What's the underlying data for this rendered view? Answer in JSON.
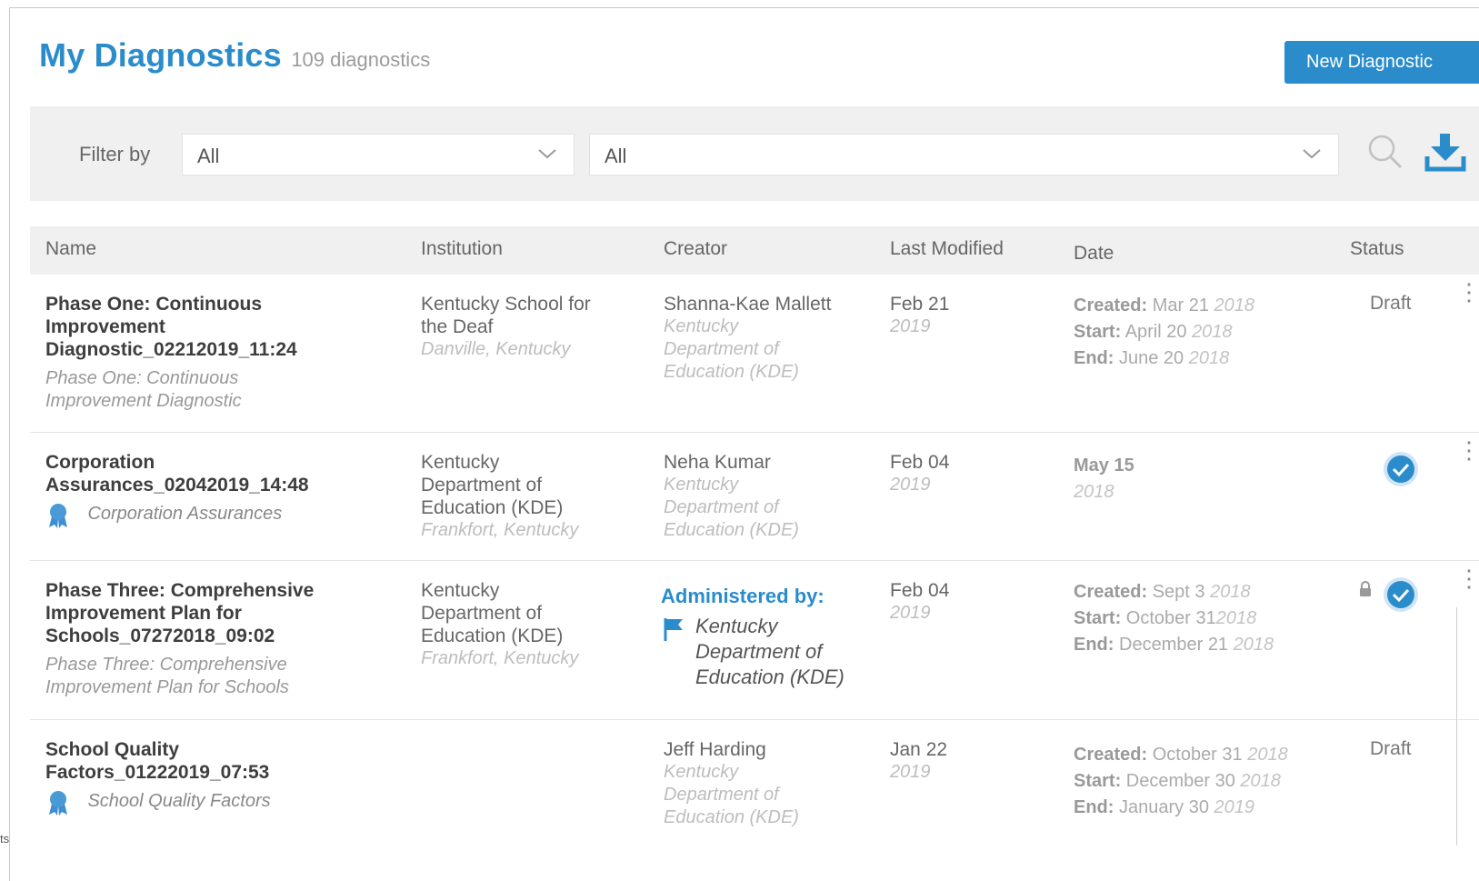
{
  "header": {
    "title": "My Diagnostics",
    "count": "109 diagnostics",
    "new_button": "New Diagnostic"
  },
  "filter": {
    "label": "Filter by",
    "select1": "All",
    "select2": "All",
    "icons": [
      "search-icon",
      "download-icon",
      "chevron-down-icon"
    ]
  },
  "columns": [
    "Name",
    "Institution",
    "Creator",
    "Last Modified",
    "Date",
    "Status"
  ],
  "rows": [
    {
      "name_lines": [
        "Phase One: Continuous",
        "Improvement",
        "Diagnostic_02212019_11:24"
      ],
      "sub_lines": [
        "Phase One: Continuous",
        "Improvement Diagnostic"
      ],
      "institution_lines": [
        "Kentucky School for",
        "the Deaf"
      ],
      "institution_location": "Danville, Kentucky",
      "creator": "Shanna-Kae Mallett",
      "creator_org_lines": [
        "Kentucky",
        "Department of",
        "Education (KDE)"
      ],
      "modified_date": "Feb 21",
      "modified_year": "2019",
      "created_label": "Created:",
      "created_date": "Mar 21",
      "created_year": "2018",
      "start_label": "Start:",
      "start_date": "April 20",
      "start_year": "2018",
      "end_label": "End:",
      "end_date": "June 20",
      "end_year": "2018",
      "status": "Draft"
    },
    {
      "name_lines": [
        "Corporation",
        "Assurances_02042019_14:48"
      ],
      "sub": "Corporation Assurances",
      "institution_lines": [
        "Kentucky",
        "Department of",
        "Education (KDE)"
      ],
      "institution_location": "Frankfort, Kentucky",
      "creator": "Neha Kumar",
      "creator_org_lines": [
        "Kentucky",
        "Department of",
        "Education (KDE)"
      ],
      "modified_date": "Feb 04",
      "modified_year": "2019",
      "date_main": "May 15",
      "date_year": "2018",
      "status": "complete"
    },
    {
      "name_lines": [
        "Phase Three: Comprehensive",
        "Improvement Plan for",
        "Schools_07272018_09:02"
      ],
      "sub_lines": [
        "Phase Three: Comprehensive",
        "Improvement Plan for Schools"
      ],
      "institution_lines": [
        "Kentucky",
        "Department of",
        "Education (KDE)"
      ],
      "institution_location": "Frankfort, Kentucky",
      "admin_label": "Administered by:",
      "admin_org_lines": [
        "Kentucky",
        "Department of",
        "Education (KDE)"
      ],
      "modified_date": "Feb 04",
      "modified_year": "2019",
      "created_label": "Created:",
      "created_date": "Sept 3",
      "created_year": "2018",
      "start_label": "Start:",
      "start_date": "October 31",
      "start_year": "2018",
      "end_label": "End:",
      "end_date": "December 21",
      "end_year": "2018",
      "status": "locked-complete"
    },
    {
      "name_lines": [
        "School Quality",
        "Factors_01222019_07:53"
      ],
      "sub": "School Quality Factors",
      "creator": "Jeff Harding",
      "creator_org_lines": [
        "Kentucky",
        "Department of",
        "Education (KDE)"
      ],
      "modified_date": "Jan 22",
      "modified_year": "2019",
      "created_label": "Created:",
      "created_date": "October 31",
      "created_year": "2018",
      "start_label": "Start:",
      "start_date": "December 30",
      "start_year": "2018",
      "end_label": "End:",
      "end_date": "January 30",
      "end_year": "2019",
      "status": "Draft"
    }
  ],
  "corner_text": "ts",
  "colors": {
    "accent": "#2b8ccc",
    "bar": "#f0f0f0"
  }
}
